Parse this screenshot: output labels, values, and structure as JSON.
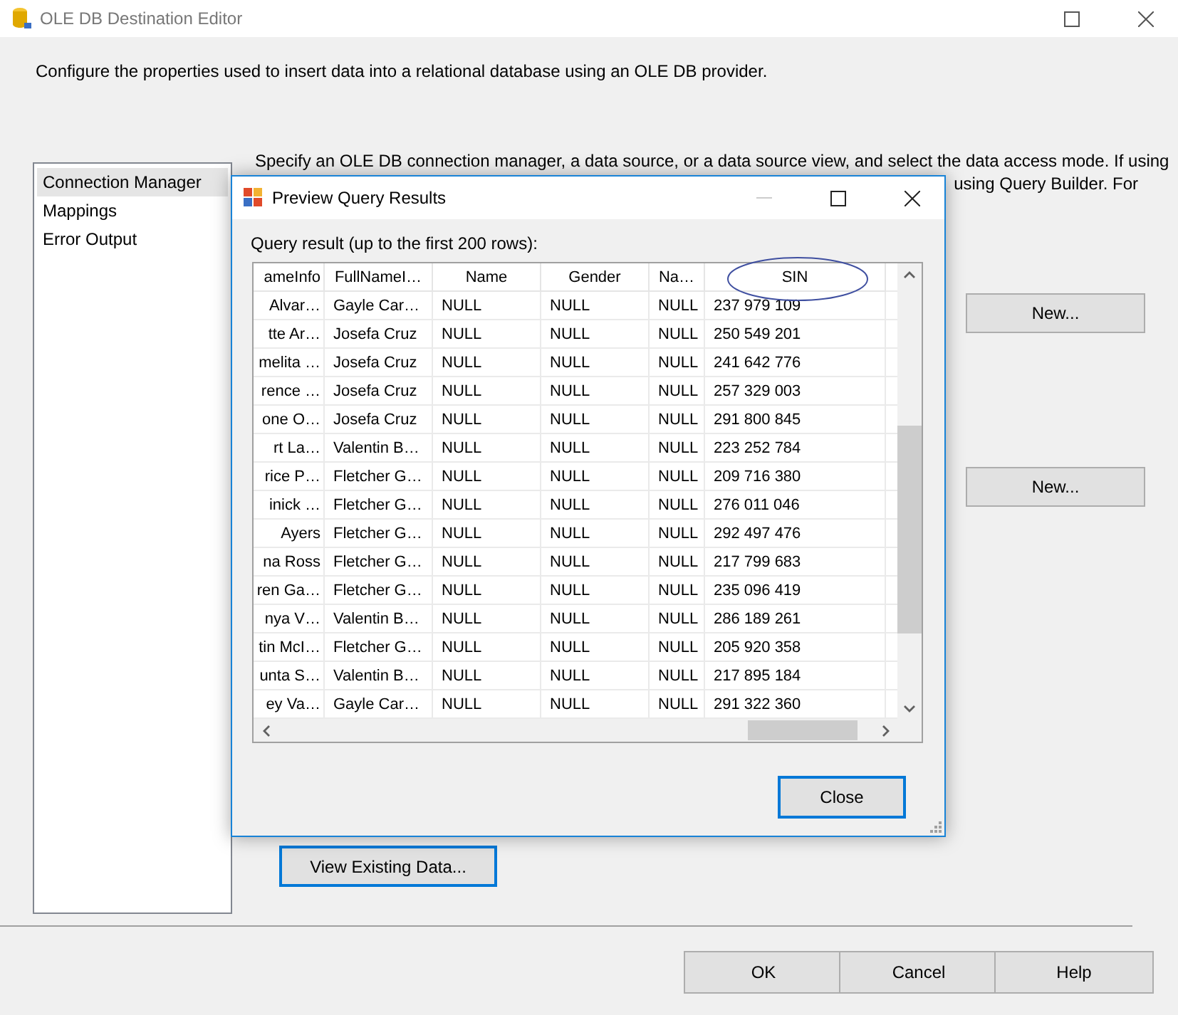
{
  "window": {
    "title": "OLE DB Destination Editor"
  },
  "description": "Configure the properties used to insert data into a relational database using an OLE DB provider.",
  "sidebar": {
    "items": [
      {
        "label": "Connection Manager",
        "selected": true
      },
      {
        "label": "Mappings",
        "selected": false
      },
      {
        "label": "Error Output",
        "selected": false
      }
    ]
  },
  "panel": {
    "intro_line_1": "Specify an OLE DB connection manager, a data source, or a data source view, and select the data access mode. If using",
    "intro_line_2": "using Query Builder. For",
    "new_buttons": [
      "New...",
      "New..."
    ],
    "view_button": {
      "label": "View Existing Data...",
      "focused": true
    }
  },
  "preview": {
    "title": "Preview Query Results",
    "caption": "Query result (up to the first 200 rows):",
    "columns": [
      {
        "label": "ameInfo",
        "highlighted": false
      },
      {
        "label": "FullNameI…",
        "highlighted": false
      },
      {
        "label": "Name",
        "highlighted": false
      },
      {
        "label": "Gender",
        "highlighted": false
      },
      {
        "label": "Na…",
        "highlighted": false
      },
      {
        "label": "SIN",
        "highlighted": true
      }
    ],
    "rows": [
      [
        "Alvar…",
        "Gayle Car…",
        "NULL",
        "NULL",
        "NULL",
        "237 979 109"
      ],
      [
        "tte Ar…",
        "Josefa Cruz",
        "NULL",
        "NULL",
        "NULL",
        "250 549 201"
      ],
      [
        "melita …",
        "Josefa Cruz",
        "NULL",
        "NULL",
        "NULL",
        "241 642 776"
      ],
      [
        "rence …",
        "Josefa Cruz",
        "NULL",
        "NULL",
        "NULL",
        "257 329 003"
      ],
      [
        "one O…",
        "Josefa Cruz",
        "NULL",
        "NULL",
        "NULL",
        "291 800 845"
      ],
      [
        "rt La…",
        "Valentin B…",
        "NULL",
        "NULL",
        "NULL",
        "223 252 784"
      ],
      [
        "rice P…",
        "Fletcher G…",
        "NULL",
        "NULL",
        "NULL",
        "209 716 380"
      ],
      [
        "inick …",
        "Fletcher G…",
        "NULL",
        "NULL",
        "NULL",
        "276 011 046"
      ],
      [
        "Ayers",
        "Fletcher G…",
        "NULL",
        "NULL",
        "NULL",
        "292 497 476"
      ],
      [
        "na Ross",
        "Fletcher G…",
        "NULL",
        "NULL",
        "NULL",
        "217 799 683"
      ],
      [
        "ren Ga…",
        "Fletcher G…",
        "NULL",
        "NULL",
        "NULL",
        "235 096 419"
      ],
      [
        "nya V…",
        "Valentin B…",
        "NULL",
        "NULL",
        "NULL",
        "286 189 261"
      ],
      [
        "tin McI…",
        "Fletcher G…",
        "NULL",
        "NULL",
        "NULL",
        "205 920 358"
      ],
      [
        "unta S…",
        "Valentin B…",
        "NULL",
        "NULL",
        "NULL",
        "217 895 184"
      ],
      [
        "ey Va…",
        "Gayle Car…",
        "NULL",
        "NULL",
        "NULL",
        "291 322 360"
      ]
    ],
    "close_button": {
      "label": "Close",
      "focused": true
    }
  },
  "buttons": [
    "OK",
    "Cancel",
    "Help"
  ]
}
